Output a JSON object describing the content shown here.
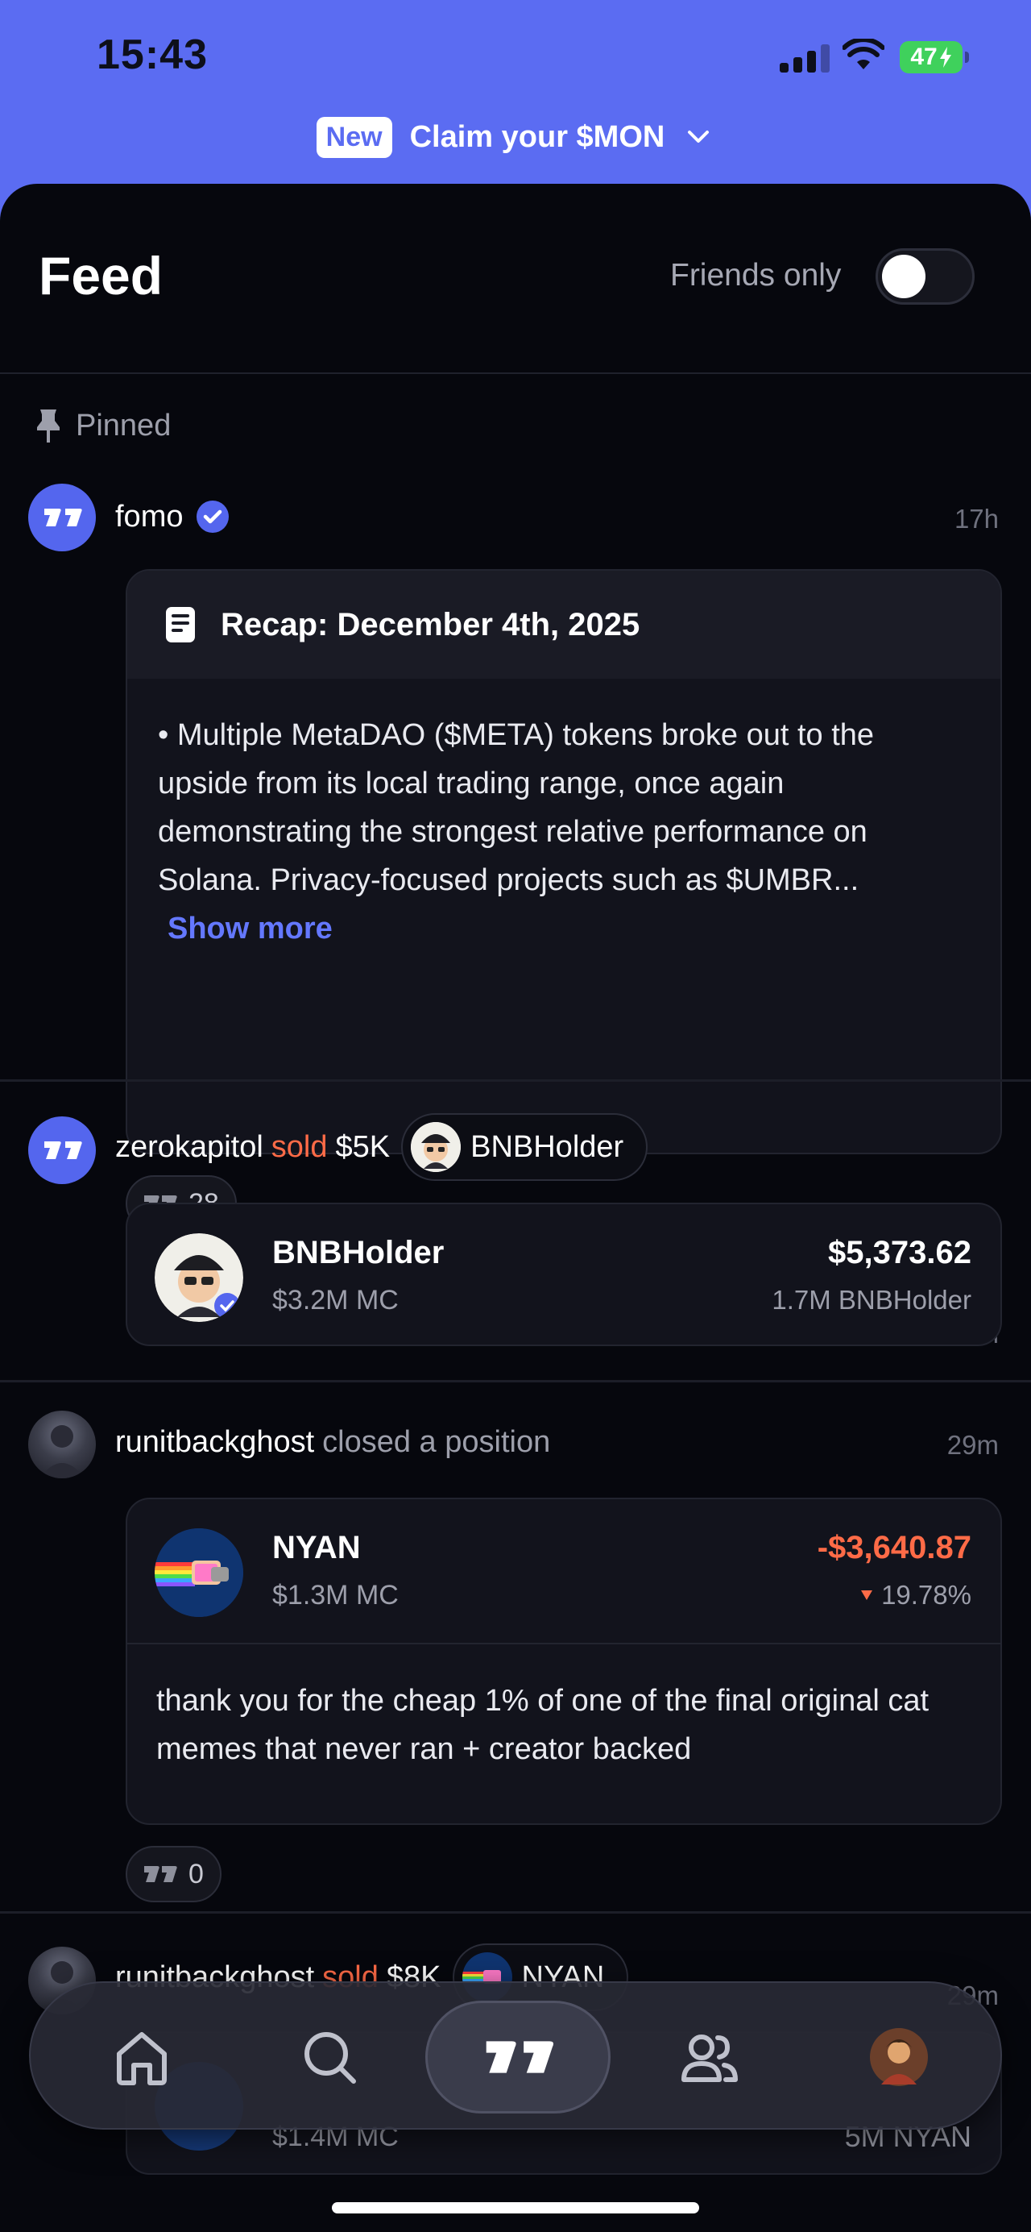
{
  "status_bar": {
    "time": "15:43",
    "battery": "47"
  },
  "promo": {
    "badge": "New",
    "text": "Claim your $MON"
  },
  "header": {
    "title": "Feed",
    "friends_only_label": "Friends only",
    "friends_only_on": false
  },
  "pinned_label": "Pinned",
  "posts": [
    {
      "user": "fomo",
      "verified": true,
      "time": "17h",
      "recap_title": "Recap: December 4th, 2025",
      "recap_text": "• Multiple MetaDAO ($META) tokens broke out to the upside from its local trading range, once again demonstrating the strongest relative performance on Solana. Privacy-focused projects such as $UMBR...",
      "show_more": "Show more",
      "reactions": "28"
    },
    {
      "user": "zerokapitol",
      "action": "sold",
      "amount": "$5K",
      "token_pill": "BNBHolder",
      "time": "16m",
      "token": {
        "name": "BNBHolder",
        "mc": "$3.2M MC",
        "value": "$5,373.62",
        "holding": "1.7M BNBHolder"
      }
    },
    {
      "user": "runitbackghost",
      "action": "closed a position",
      "time": "29m",
      "token": {
        "name": "NYAN",
        "mc": "$1.3M MC",
        "value": "-$3,640.87",
        "change": "19.78%"
      },
      "note": "thank you for the cheap 1% of one of the final original cat memes that never ran + creator backed",
      "reactions": "0"
    },
    {
      "user": "runitbackghost",
      "action": "sold",
      "amount": "$8K",
      "token_pill": "NYAN",
      "time": "29m",
      "token": {
        "mc": "$1.4M MC",
        "holding": "5M NYAN"
      }
    }
  ],
  "nav": {
    "items": [
      "home-icon",
      "search-icon",
      "fomo-logo-icon",
      "friends-icon",
      "profile-avatar"
    ],
    "active": "fomo-logo-icon"
  },
  "colors": {
    "accent": "#5b6cf2",
    "sold": "#ff6b47",
    "background": "#06070d",
    "link": "#6478ff"
  }
}
